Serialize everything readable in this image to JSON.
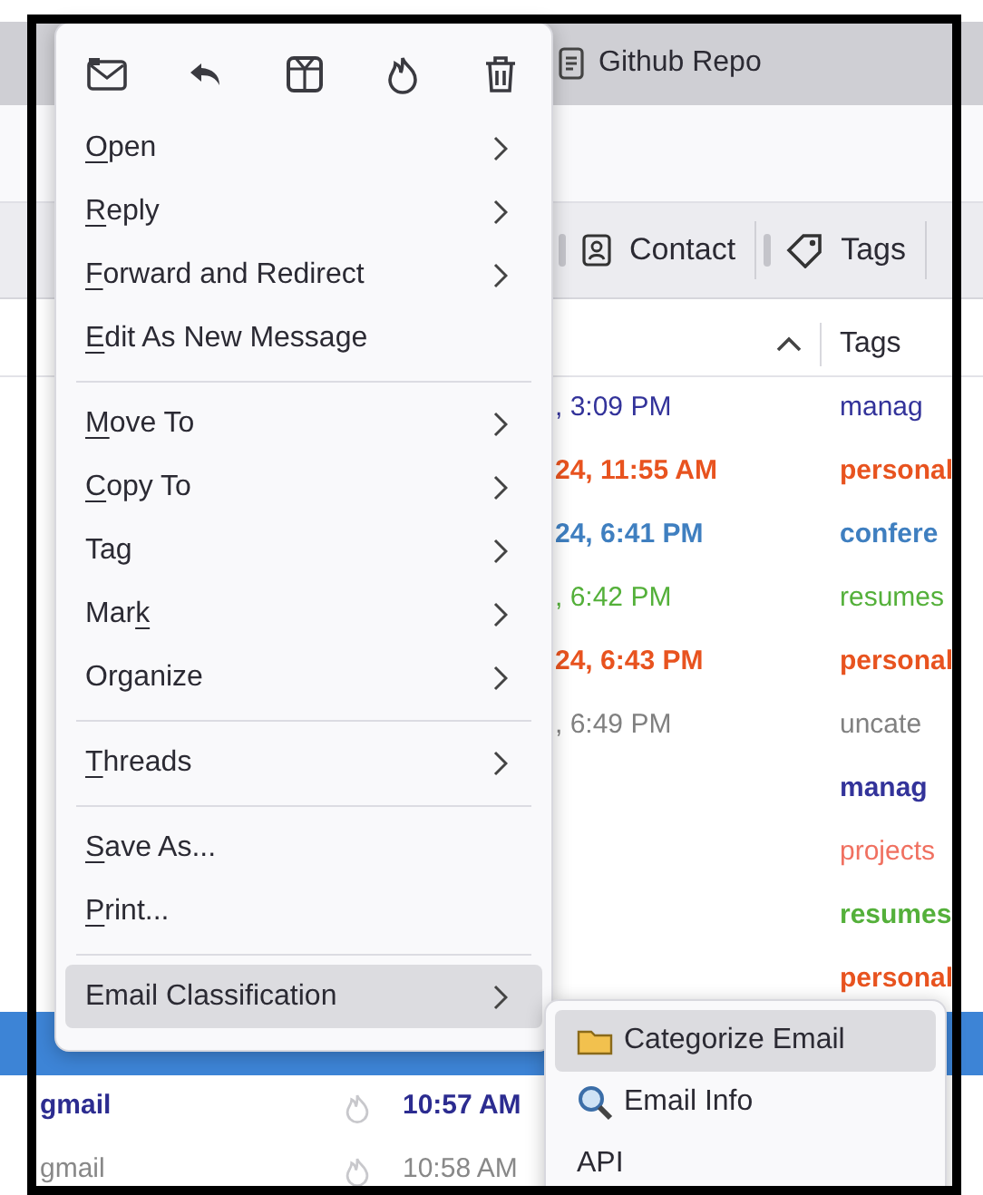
{
  "tab": {
    "label": "Github Repo"
  },
  "filter_bar": {
    "buttons": [
      {
        "label": "Contact",
        "kind": "contact"
      },
      {
        "label": "Tags",
        "kind": "tags"
      }
    ]
  },
  "column_header": {
    "columns": [
      {
        "label": "Tags"
      }
    ]
  },
  "messages": [
    {
      "kind": "dated",
      "date": ", 3:09 PM",
      "tag": "manag",
      "color": "#33339a",
      "unread": false,
      "selected": false
    },
    {
      "kind": "dated",
      "date": "24, 11:55 AM",
      "tag": "personal",
      "color": "#e8531f",
      "unread": true,
      "selected": false
    },
    {
      "kind": "dated",
      "date": "24, 6:41 PM",
      "tag": "confere",
      "color": "#3f7fc0",
      "unread": true,
      "selected": false
    },
    {
      "kind": "dated",
      "date": ", 6:42 PM",
      "tag": "resumes",
      "color": "#54b03a",
      "unread": false,
      "selected": false
    },
    {
      "kind": "dated",
      "date": "24, 6:43 PM",
      "tag": "personal",
      "color": "#e8531f",
      "unread": true,
      "selected": false
    },
    {
      "kind": "dated",
      "date": ", 6:49 PM",
      "tag": "uncate",
      "color": "#808080",
      "unread": false,
      "selected": false
    },
    {
      "kind": "dated",
      "tag": "manag",
      "color": "#33339a",
      "unread": true,
      "selected": false
    },
    {
      "kind": "dated",
      "tag": "projects",
      "color": "#f07060",
      "unread": false,
      "selected": false
    },
    {
      "kind": "dated",
      "tag": "resumes",
      "color": "#54b03a",
      "unread": true,
      "selected": false
    },
    {
      "kind": "dated",
      "tag": "personal",
      "color": "#e8531f",
      "unread": true,
      "selected": false
    },
    {
      "kind": "dated",
      "unread": false,
      "selected": true
    },
    {
      "kind": "today",
      "sender": "gmail",
      "date": "10:57 AM",
      "color": "#2c2c90",
      "unread": true,
      "selected": false
    },
    {
      "kind": "today",
      "sender": "gmail",
      "date": "10:58 AM",
      "color": "#888888",
      "unread": false,
      "selected": false
    }
  ],
  "context_menu": {
    "items": [
      {
        "kind": "item",
        "access_key": "O",
        "text_after": "pen",
        "submenu": true,
        "selected": false
      },
      {
        "kind": "item",
        "access_key": "R",
        "text_after": "eply",
        "submenu": true,
        "selected": false
      },
      {
        "kind": "item",
        "access_key": "F",
        "text_after": "orward and Redirect",
        "submenu": true,
        "selected": false
      },
      {
        "kind": "item",
        "access_key": "E",
        "text_after": "dit As New Message",
        "submenu": false,
        "selected": false
      },
      {
        "kind": "separator"
      },
      {
        "kind": "item",
        "access_key": "M",
        "text_after": "ove To",
        "submenu": true,
        "selected": false
      },
      {
        "kind": "item",
        "access_key": "C",
        "text_after": "opy To",
        "submenu": true,
        "selected": false
      },
      {
        "kind": "item",
        "text_before": "Tag",
        "submenu": true,
        "selected": false
      },
      {
        "kind": "item",
        "text_before": "Mar",
        "access_key": "k",
        "submenu": true,
        "selected": false
      },
      {
        "kind": "item",
        "text_before": "Organize",
        "submenu": true,
        "selected": false
      },
      {
        "kind": "separator"
      },
      {
        "kind": "item",
        "access_key": "T",
        "text_after": "hreads",
        "submenu": true,
        "selected": false
      },
      {
        "kind": "separator"
      },
      {
        "kind": "item",
        "access_key": "S",
        "text_after": "ave As...",
        "submenu": false,
        "selected": false
      },
      {
        "kind": "item",
        "access_key": "P",
        "text_after": "rint...",
        "submenu": false,
        "selected": false
      },
      {
        "kind": "separator"
      },
      {
        "kind": "item",
        "text_before": "Email Classification",
        "submenu": true,
        "selected": true
      }
    ]
  },
  "submenu": {
    "items": [
      {
        "label": "Categorize Email",
        "selected": true
      },
      {
        "label": "Email Info",
        "selected": false
      },
      {
        "label": "API",
        "selected": false
      }
    ]
  }
}
